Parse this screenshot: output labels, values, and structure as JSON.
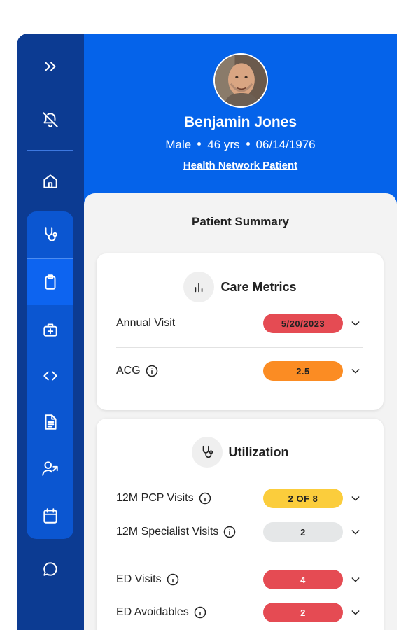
{
  "patient": {
    "name": "Benjamin Jones",
    "sex": "Male",
    "age": "46 yrs",
    "dob": "06/14/1976",
    "network_label": "Health Network Patient"
  },
  "summary": {
    "title": "Patient Summary"
  },
  "care_metrics": {
    "title": "Care Metrics",
    "icon": "bar-chart-icon",
    "rows": [
      {
        "label": "Annual Visit",
        "value": "5/20/2023",
        "color": "#e54b53",
        "has_info": false
      },
      {
        "label": "ACG",
        "value": "2.5",
        "color": "#fb8c23",
        "has_info": true
      }
    ]
  },
  "utilization": {
    "title": "Utilization",
    "icon": "stethoscope-icon",
    "rows": [
      {
        "label": "12M PCP Visits",
        "value": "2 OF 8",
        "color": "#fbcd3c",
        "has_info": true
      },
      {
        "label": "12M Specialist Visits",
        "value": "2",
        "color": "#e5e7e8",
        "has_info": true
      },
      {
        "label": "ED Visits",
        "value": "4",
        "color": "#e54b53",
        "has_info": true
      },
      {
        "label": "ED Avoidables",
        "value": "2",
        "color": "#e54b53",
        "has_info": true
      }
    ]
  },
  "sidebar": {
    "items": [
      "expand-icon",
      "notifications-off-icon",
      "home-icon",
      "stethoscope-icon",
      "clipboard-icon",
      "medical-kit-icon",
      "code-icon",
      "document-icon",
      "user-referral-icon",
      "calendar-icon",
      "chat-icon"
    ],
    "active": "clipboard-icon"
  },
  "colors": {
    "sidebar_bg": "#0c3b92",
    "header_bg": "#0563ea",
    "active_item": "#0d64f0"
  }
}
